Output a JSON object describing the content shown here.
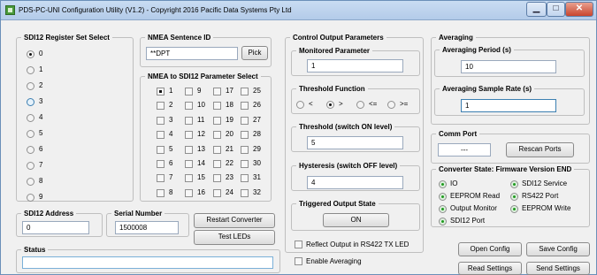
{
  "window": {
    "title": "PDS-PC-UNI Configuration Utility (V1.2) - Copyright 2016 Pacific Data Systems Pty Ltd",
    "minimize": "▁",
    "maximize": "□",
    "close": "✕"
  },
  "register": {
    "legend": "SDI12 Register Set Select",
    "options": [
      "0",
      "1",
      "2",
      "3",
      "4",
      "5",
      "6",
      "7",
      "8",
      "9"
    ],
    "selected": "0",
    "focused": "3"
  },
  "nmea": {
    "legend": "NMEA Sentence ID",
    "value": "**DPT",
    "pick": "Pick"
  },
  "param_select": {
    "legend": "NMEA to SDI12 Parameter Select",
    "columns": [
      [
        "1",
        "2",
        "3",
        "4",
        "5",
        "6",
        "7",
        "8"
      ],
      [
        "9",
        "10",
        "11",
        "12",
        "13",
        "14",
        "15",
        "16"
      ],
      [
        "17",
        "18",
        "19",
        "20",
        "21",
        "22",
        "23",
        "24"
      ],
      [
        "25",
        "26",
        "27",
        "28",
        "29",
        "30",
        "31",
        "32"
      ]
    ],
    "checked": "1"
  },
  "address": {
    "legend": "SDI12 Address",
    "value": "0"
  },
  "serial": {
    "legend": "Serial Number",
    "value": "1500008"
  },
  "buttons": {
    "restart": "Restart Converter",
    "test_leds": "Test LEDs",
    "open_config": "Open Config",
    "save_config": "Save Config",
    "read_settings": "Read Settings",
    "send_settings": "Send Settings",
    "rescan": "Rescan Ports"
  },
  "status": {
    "legend": "Status",
    "value": ""
  },
  "control": {
    "legend": "Control Output Parameters",
    "monitored": {
      "legend": "Monitored Parameter",
      "value": "1"
    },
    "threshold_fn": {
      "legend": "Threshold Function",
      "options": [
        "<",
        ">",
        "<=",
        ">="
      ],
      "selected": ">"
    },
    "threshold_on": {
      "legend": "Threshold (switch ON level)",
      "value": "5"
    },
    "hysteresis": {
      "legend": "Hysteresis (switch OFF level)",
      "value": "4"
    },
    "triggered": {
      "legend": "Triggered Output State",
      "value": "ON"
    },
    "reflect": "Reflect Output in RS422 TX LED",
    "enable_avg": "Enable Averaging"
  },
  "averaging": {
    "legend": "Averaging",
    "period": {
      "legend": "Averaging Period (s)",
      "value": "10"
    },
    "rate": {
      "legend": "Averaging Sample Rate (s)",
      "value": "1"
    }
  },
  "comm": {
    "legend": "Comm Port",
    "value": "---"
  },
  "state": {
    "legend": "Converter State:  Firmware Version END",
    "indicators": [
      "IO",
      "SDI12 Service",
      "EEPROM Read",
      "RS422 Port",
      "Output Monitor",
      "EEPROM Write",
      "SDI12 Port"
    ]
  }
}
